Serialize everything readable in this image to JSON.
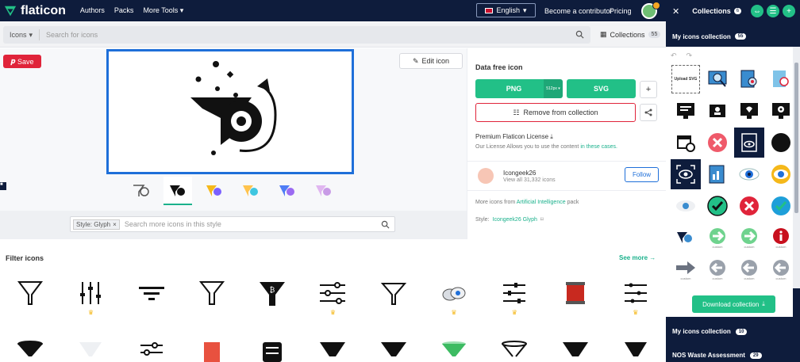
{
  "topbar": {
    "brand": "flaticon",
    "nav": [
      "Authors",
      "Packs",
      "More Tools ▾"
    ],
    "language": "English",
    "contributor": "Become a contributor",
    "pricing": "Pricing"
  },
  "search": {
    "type": "Icons",
    "placeholder": "Search for icons",
    "collections_label": "Collections",
    "collections_count": "55"
  },
  "detail": {
    "save": "Save",
    "edit": "Edit icon"
  },
  "style_search": {
    "chip": "Style: Glyph",
    "placeholder": "Search more icons in this style"
  },
  "download": {
    "title": "Data free icon",
    "png": "PNG",
    "png_size": "512px ▾",
    "svg": "SVG",
    "plus": "+",
    "remove": "Remove from collection",
    "premium_title": "Premium Flaticon License",
    "premium_text": "Our License Allows you to use the content",
    "premium_link": "in these cases.",
    "author": "Icongeek26",
    "author_sub": "View all 31,332 icons",
    "follow": "Follow",
    "pack_prefix": "More icons from",
    "pack_link": "Artificial Intelligence",
    "pack_suffix": "pack",
    "style_prefix": "Style:",
    "style_link": "Icongeek26 Glyph"
  },
  "filter": {
    "title": "Filter icons",
    "see_more": "See more"
  },
  "panel": {
    "title": "Collections",
    "title_count": "6",
    "my_collection": "My icons collection",
    "my_count": "55",
    "upload": "Upload SVG",
    "custom": "custom",
    "download_btn": "Download collection",
    "footer1": "My icons collection",
    "footer1_count": "10",
    "footer2": "NOS Waste Assessment",
    "footer2_count": "29"
  },
  "colors": {
    "navy": "#0e1c3c",
    "green": "#22c087",
    "red": "#e0243a",
    "blue": "#1e6fd9"
  }
}
